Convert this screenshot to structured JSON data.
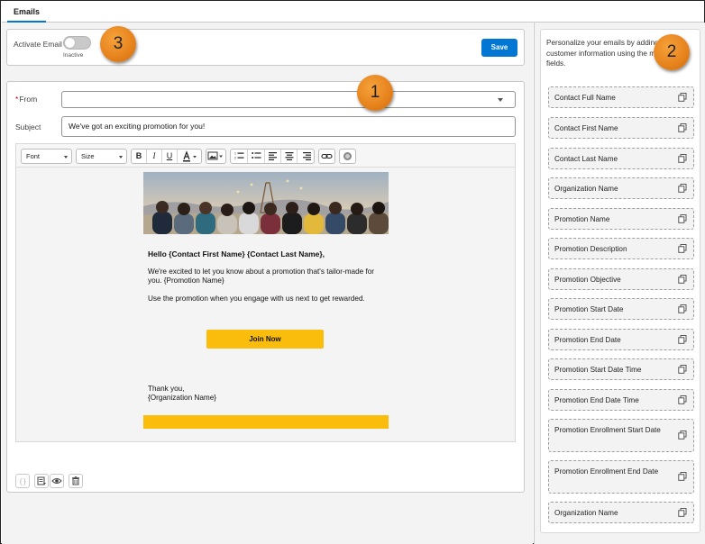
{
  "tabs": [
    {
      "label": "Emails"
    }
  ],
  "activate": {
    "label": "Activate Email",
    "state": "Inactive",
    "save_label": "Save"
  },
  "form": {
    "from_label": "From",
    "from_value": "",
    "subject_label": "Subject",
    "subject_value": "We've got an exciting promotion for you!"
  },
  "toolbar": {
    "font_label": "Font",
    "size_label": "Size"
  },
  "email": {
    "greeting": "Hello {Contact First Name} {Contact Last Name},",
    "paragraph1": "We're excited to let you know about a promotion that's tailor-made for you. {Promotion Name}",
    "paragraph2": "Use the promotion when you engage with us next to get rewarded.",
    "cta_label": "Join Now",
    "signoff": "Thank you,",
    "signature": "{Organization Name}"
  },
  "merge_panel": {
    "intro": "Personalize your emails by adding customer information using the merge fields.",
    "fields": [
      {
        "label": "Contact Full Name"
      },
      {
        "label": "Contact First Name"
      },
      {
        "label": "Contact Last Name"
      },
      {
        "label": "Organization Name"
      },
      {
        "label": "Promotion Name"
      },
      {
        "label": "Promotion Description"
      },
      {
        "label": "Promotion Objective"
      },
      {
        "label": "Promotion Start Date"
      },
      {
        "label": "Promotion End Date"
      },
      {
        "label": "Promotion Start Date Time"
      },
      {
        "label": "Promotion End Date Time"
      },
      {
        "label": "Promotion Enrollment Start Date"
      },
      {
        "label": "Promotion Enrollment End Date"
      },
      {
        "label": "Organization Name"
      }
    ]
  },
  "callouts": [
    "1",
    "2",
    "3"
  ],
  "colors": {
    "brand_blue": "#0176d3",
    "cta_yellow": "#fbbd0b",
    "callout_orange": "#e6821c",
    "required_red": "#ba0517"
  }
}
